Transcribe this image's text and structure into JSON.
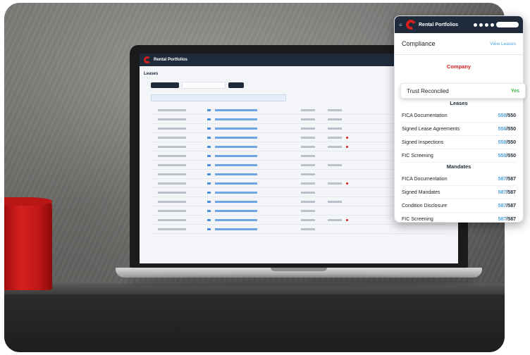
{
  "laptop_app": {
    "title": "Rental Portfolios",
    "section": "Leases"
  },
  "card": {
    "title": "Rental Portfolios",
    "compliance_title": "Compliance",
    "view_leases": "View Leases",
    "company_label": "Company",
    "trust": {
      "label": "Trust Reconciled",
      "value": "Yes"
    },
    "leases_heading": "Leases",
    "leases": [
      {
        "label": "FICA Documentation",
        "num": "550",
        "den": "/550"
      },
      {
        "label": "Signed Lease Agreements",
        "num": "550",
        "den": "/550"
      },
      {
        "label": "Signed Inspections",
        "num": "550",
        "den": "/550"
      },
      {
        "label": "FIC Screening",
        "num": "550",
        "den": "/550"
      }
    ],
    "mandates_heading": "Mandates",
    "mandates": [
      {
        "label": "FICA Documentation",
        "num": "587",
        "den": "/587"
      },
      {
        "label": "Signed Mandates",
        "num": "587",
        "den": "/587"
      },
      {
        "label": "Condition Disclosure",
        "num": "587",
        "den": "/587"
      },
      {
        "label": "FIC Screening",
        "num": "587",
        "den": "/587"
      }
    ],
    "colors": {
      "header": "#1f2b3b",
      "brand_red": "#d62020",
      "link_blue": "#4aa3df",
      "success_green": "#3bb54a"
    }
  }
}
